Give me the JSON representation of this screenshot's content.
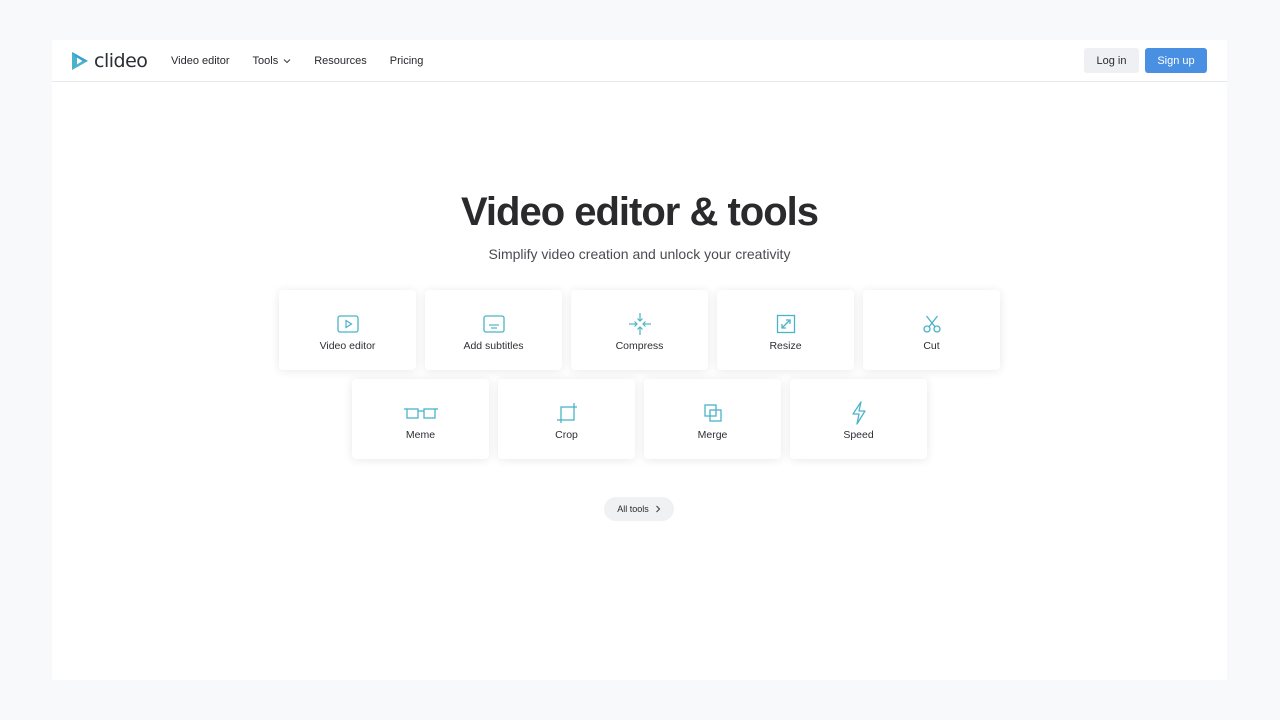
{
  "brand": {
    "name": "clideo",
    "accent": "#4bb3c8"
  },
  "nav": {
    "items": [
      {
        "label": "Video editor"
      },
      {
        "label": "Tools",
        "has_dropdown": true
      },
      {
        "label": "Resources"
      },
      {
        "label": "Pricing"
      }
    ]
  },
  "auth": {
    "login_label": "Log in",
    "signup_label": "Sign up",
    "signup_color": "#4a90e2"
  },
  "hero": {
    "title": "Video editor & tools",
    "subtitle": "Simplify video creation and unlock your creativity"
  },
  "tools": {
    "row1": [
      {
        "label": "Video editor",
        "icon": "play-screen-icon"
      },
      {
        "label": "Add subtitles",
        "icon": "subtitles-icon"
      },
      {
        "label": "Compress",
        "icon": "compress-icon"
      },
      {
        "label": "Resize",
        "icon": "resize-icon"
      },
      {
        "label": "Cut",
        "icon": "scissors-icon"
      }
    ],
    "row2": [
      {
        "label": "Meme",
        "icon": "meme-icon"
      },
      {
        "label": "Crop",
        "icon": "crop-icon"
      },
      {
        "label": "Merge",
        "icon": "merge-icon"
      },
      {
        "label": "Speed",
        "icon": "lightning-icon"
      }
    ]
  },
  "all_tools": {
    "label": "All tools"
  }
}
